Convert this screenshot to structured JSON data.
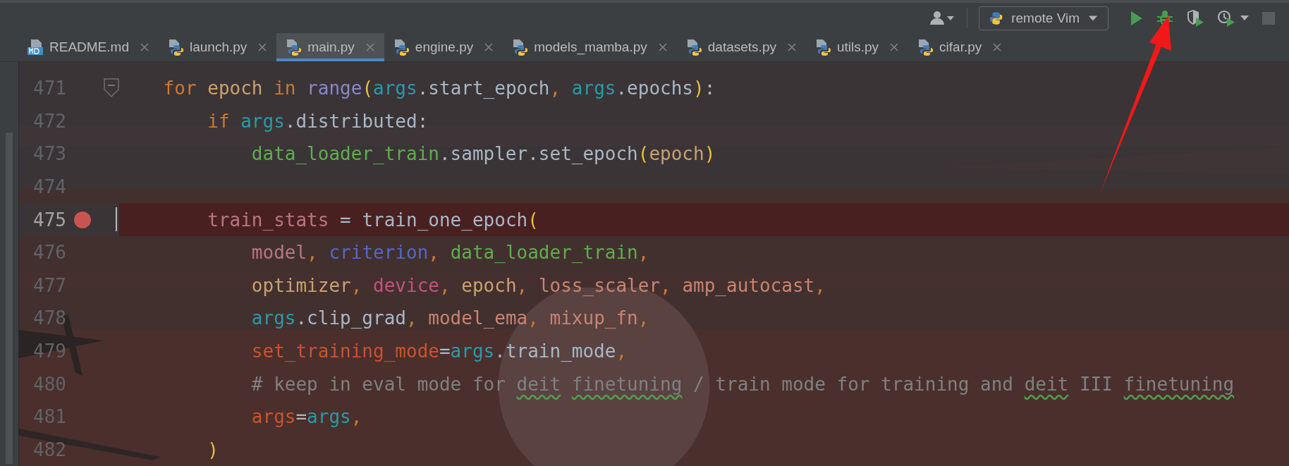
{
  "toolbar": {
    "run_config": "remote Vim"
  },
  "tabs": [
    {
      "label": "README.md",
      "kind": "markdown",
      "selected": false
    },
    {
      "label": "launch.py",
      "kind": "python",
      "selected": false
    },
    {
      "label": "main.py",
      "kind": "python",
      "selected": true
    },
    {
      "label": "engine.py",
      "kind": "python",
      "selected": false
    },
    {
      "label": "models_mamba.py",
      "kind": "python",
      "selected": false
    },
    {
      "label": "datasets.py",
      "kind": "python",
      "selected": false
    },
    {
      "label": "utils.py",
      "kind": "python",
      "selected": false
    },
    {
      "label": "cifar.py",
      "kind": "python",
      "selected": false
    }
  ],
  "editor": {
    "lines": [
      {
        "number": "471",
        "breakpoint": false,
        "caret": false,
        "fold": true,
        "tokens": [
          {
            "text": "    for",
            "kind": "keyword"
          },
          {
            "text": " epoch",
            "kind": "local"
          },
          {
            "text": " in",
            "kind": "keyword"
          },
          {
            "text": " range",
            "kind": "builtin"
          },
          {
            "text": "(",
            "kind": "bracket"
          },
          {
            "text": "args",
            "kind": "param"
          },
          {
            "text": ".start_epoch",
            "kind": "text"
          },
          {
            "text": ", ",
            "kind": "comma"
          },
          {
            "text": "args",
            "kind": "param"
          },
          {
            "text": ".epochs",
            "kind": "text"
          },
          {
            "text": ")",
            "kind": "bracket"
          },
          {
            "text": ":",
            "kind": "text"
          }
        ]
      },
      {
        "number": "472",
        "breakpoint": false,
        "caret": false,
        "fold": false,
        "tokens": [
          {
            "text": "        if",
            "kind": "keyword"
          },
          {
            "text": " args",
            "kind": "param"
          },
          {
            "text": ".distributed:",
            "kind": "text"
          }
        ]
      },
      {
        "number": "473",
        "breakpoint": false,
        "caret": false,
        "fold": false,
        "tokens": [
          {
            "text": "            data_loader_train",
            "kind": "func"
          },
          {
            "text": ".sampler.set_epoch",
            "kind": "text"
          },
          {
            "text": "(",
            "kind": "bracket"
          },
          {
            "text": "epoch",
            "kind": "local"
          },
          {
            "text": ")",
            "kind": "bracket"
          }
        ]
      },
      {
        "number": "474",
        "breakpoint": false,
        "caret": false,
        "fold": false
      },
      {
        "number": "475",
        "breakpoint": true,
        "caret": true,
        "fold": false,
        "tokens": [
          {
            "text": "        train_stats",
            "kind": "var"
          },
          {
            "text": " = train_one_epoch",
            "kind": "text"
          },
          {
            "text": "(",
            "kind": "bracket"
          }
        ]
      },
      {
        "number": "476",
        "breakpoint": false,
        "caret": false,
        "fold": false,
        "tokens": [
          {
            "text": "            model",
            "kind": "var"
          },
          {
            "text": ", ",
            "kind": "comma"
          },
          {
            "text": "criterion",
            "kind": "ref"
          },
          {
            "text": ", ",
            "kind": "comma"
          },
          {
            "text": "data_loader_train",
            "kind": "func"
          },
          {
            "text": ",",
            "kind": "comma"
          }
        ]
      },
      {
        "number": "477",
        "breakpoint": false,
        "caret": false,
        "fold": false,
        "tokens": [
          {
            "text": "            optimizer",
            "kind": "local"
          },
          {
            "text": ", ",
            "kind": "comma"
          },
          {
            "text": "device",
            "kind": "device"
          },
          {
            "text": ", ",
            "kind": "comma"
          },
          {
            "text": "epoch",
            "kind": "local"
          },
          {
            "text": ", ",
            "kind": "comma"
          },
          {
            "text": "loss_scaler",
            "kind": "arg"
          },
          {
            "text": ", ",
            "kind": "comma"
          },
          {
            "text": "amp_autocast",
            "kind": "arg"
          },
          {
            "text": ",",
            "kind": "comma"
          }
        ]
      },
      {
        "number": "478",
        "breakpoint": false,
        "caret": false,
        "fold": false,
        "tokens": [
          {
            "text": "            args",
            "kind": "param"
          },
          {
            "text": ".clip_grad",
            "kind": "text"
          },
          {
            "text": ", ",
            "kind": "comma"
          },
          {
            "text": "model_ema",
            "kind": "arg"
          },
          {
            "text": ", ",
            "kind": "comma"
          },
          {
            "text": "mixup_fn",
            "kind": "arg"
          },
          {
            "text": ",",
            "kind": "comma"
          }
        ]
      },
      {
        "number": "479",
        "breakpoint": false,
        "caret": false,
        "fold": false,
        "tokens": [
          {
            "text": "            set_training_mode",
            "kind": "kwarg"
          },
          {
            "text": "=",
            "kind": "text"
          },
          {
            "text": "args",
            "kind": "param"
          },
          {
            "text": ".train_mode",
            "kind": "text"
          },
          {
            "text": ",",
            "kind": "comma"
          }
        ]
      },
      {
        "number": "480",
        "breakpoint": false,
        "caret": false,
        "fold": false,
        "tokens": [
          {
            "text": "            # keep in eval mode for ",
            "kind": "comment"
          },
          {
            "text": "deit",
            "kind": "typo"
          },
          {
            "text": " finetuning",
            "kind": "typo"
          },
          {
            "text": " / train mode for training and ",
            "kind": "comment"
          },
          {
            "text": "deit",
            "kind": "typo"
          },
          {
            "text": " III ",
            "kind": "comment"
          },
          {
            "text": "finetuning",
            "kind": "typo"
          }
        ]
      },
      {
        "number": "481",
        "breakpoint": false,
        "caret": false,
        "fold": false,
        "tokens": [
          {
            "text": "            args",
            "kind": "kwarg"
          },
          {
            "text": "=",
            "kind": "text"
          },
          {
            "text": "args",
            "kind": "param"
          },
          {
            "text": ",",
            "kind": "comma"
          }
        ]
      },
      {
        "number": "482",
        "breakpoint": false,
        "caret": false,
        "fold": false,
        "tokens": [
          {
            "text": "        )",
            "kind": "bracket"
          }
        ]
      }
    ]
  }
}
